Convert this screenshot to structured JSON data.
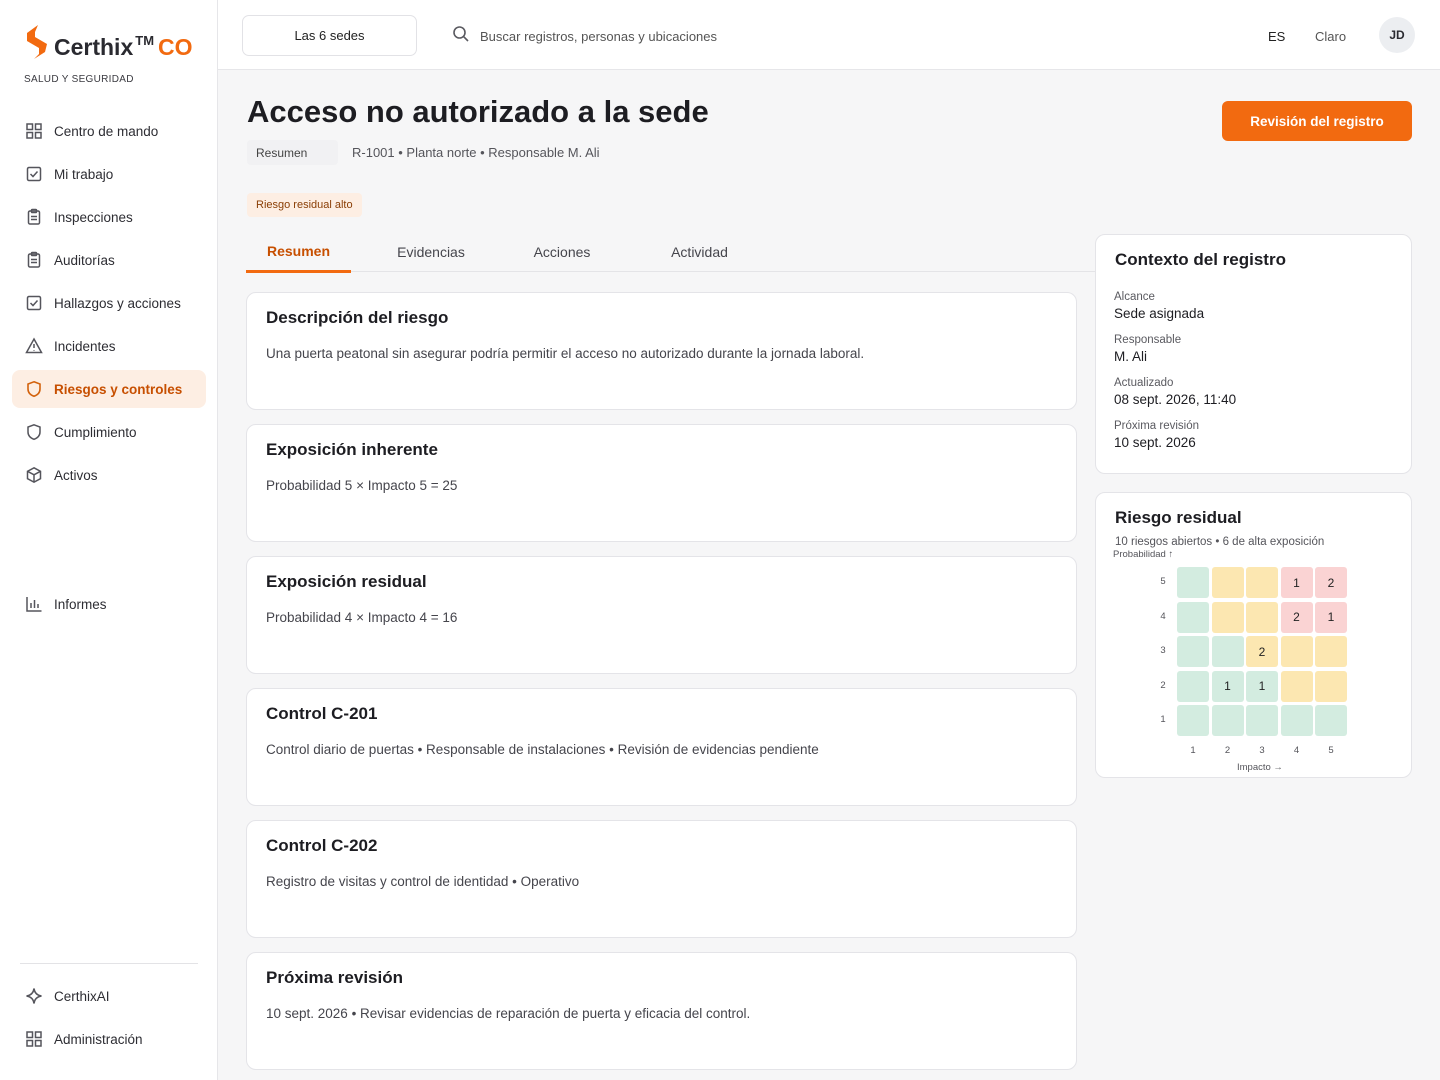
{
  "brand": {
    "name": "Certhix",
    "tm": "TM",
    "suffix": "CO",
    "subtitle": "SALUD Y SEGURIDAD",
    "accent": "#f26a10"
  },
  "sidebar": {
    "items": [
      {
        "label": "Centro de mando",
        "icon": "grid-icon"
      },
      {
        "label": "Mi trabajo",
        "icon": "checkbox-icon"
      },
      {
        "label": "Inspecciones",
        "icon": "clipboard-icon"
      },
      {
        "label": "Auditorías",
        "icon": "clipboard-icon"
      },
      {
        "label": "Hallazgos y acciones",
        "icon": "checkbox-icon"
      },
      {
        "label": "Incidentes",
        "icon": "warning-icon"
      },
      {
        "label": "Riesgos y controles",
        "icon": "shield-icon",
        "active": true
      },
      {
        "label": "Cumplimiento",
        "icon": "shield-icon"
      },
      {
        "label": "Activos",
        "icon": "cube-icon"
      }
    ],
    "reports": {
      "label": "Informes",
      "icon": "bar-chart-icon"
    },
    "bottom": [
      {
        "label": "CerthixAI",
        "icon": "sparkle-icon"
      },
      {
        "label": "Administración",
        "icon": "grid-icon"
      }
    ]
  },
  "topbar": {
    "site_select": "Las 6 sedes",
    "search_placeholder": "Buscar registros, personas y ubicaciones",
    "language": "ES",
    "theme": "Claro",
    "avatar_initials": "JD"
  },
  "header": {
    "title": "Acceso no autorizado a la sede",
    "tag": "Resumen",
    "meta": "R-1001 • Planta norte • Responsable M. Ali",
    "review_button": "Revisión del registro",
    "risk_pill": "Riesgo residual alto"
  },
  "tabs": [
    {
      "label": "Resumen",
      "active": true
    },
    {
      "label": "Evidencias"
    },
    {
      "label": "Acciones"
    },
    {
      "label": "Actividad"
    }
  ],
  "cards": [
    {
      "title": "Descripción del riesgo",
      "text": "Una puerta peatonal sin asegurar podría permitir el acceso no autorizado durante la jornada laboral."
    },
    {
      "title": "Exposición inherente",
      "text": "Probabilidad 5 × Impacto 5 = 25"
    },
    {
      "title": "Exposición residual",
      "text": "Probabilidad 4 × Impacto 4 = 16"
    },
    {
      "title": "Control C-201",
      "text": "Control diario de puertas • Responsable de instalaciones • Revisión de evidencias pendiente"
    },
    {
      "title": "Control C-202",
      "text": "Registro de visitas y control de identidad • Operativo"
    },
    {
      "title": "Próxima revisión",
      "text": "10 sept. 2026 • Revisar evidencias de reparación de puerta y eficacia del control."
    }
  ],
  "context": {
    "title": "Contexto del registro",
    "fields": [
      {
        "label": "Alcance",
        "value": "Sede asignada"
      },
      {
        "label": "Responsable",
        "value": "M. Ali"
      },
      {
        "label": "Actualizado",
        "value": "08 sept. 2026, 11:40"
      },
      {
        "label": "Próxima revisión",
        "value": "10 sept. 2026"
      }
    ]
  },
  "residual": {
    "title": "Riesgo residual",
    "subtitle": "10 riesgos abiertos • 6 de alta exposición",
    "y_axis": "Probabilidad ↑",
    "x_axis": "Impacto →",
    "y_ticks": [
      "5",
      "4",
      "3",
      "2",
      "1"
    ],
    "x_ticks": [
      "1",
      "2",
      "3",
      "4",
      "5"
    ],
    "colors": {
      "green": "#d3ece0",
      "yellow": "#fce7b1",
      "red": "#fad3d3"
    },
    "rows": [
      [
        {
          "c": "green",
          "v": ""
        },
        {
          "c": "yellow",
          "v": ""
        },
        {
          "c": "yellow",
          "v": ""
        },
        {
          "c": "red",
          "v": "1"
        },
        {
          "c": "red",
          "v": "2"
        }
      ],
      [
        {
          "c": "green",
          "v": ""
        },
        {
          "c": "yellow",
          "v": ""
        },
        {
          "c": "yellow",
          "v": ""
        },
        {
          "c": "red",
          "v": "2"
        },
        {
          "c": "red",
          "v": "1"
        }
      ],
      [
        {
          "c": "green",
          "v": ""
        },
        {
          "c": "green",
          "v": ""
        },
        {
          "c": "yellow",
          "v": "2"
        },
        {
          "c": "yellow",
          "v": ""
        },
        {
          "c": "yellow",
          "v": ""
        }
      ],
      [
        {
          "c": "green",
          "v": ""
        },
        {
          "c": "green",
          "v": "1"
        },
        {
          "c": "green",
          "v": "1"
        },
        {
          "c": "yellow",
          "v": ""
        },
        {
          "c": "yellow",
          "v": ""
        }
      ],
      [
        {
          "c": "green",
          "v": ""
        },
        {
          "c": "green",
          "v": ""
        },
        {
          "c": "green",
          "v": ""
        },
        {
          "c": "green",
          "v": ""
        },
        {
          "c": "green",
          "v": ""
        }
      ]
    ]
  }
}
